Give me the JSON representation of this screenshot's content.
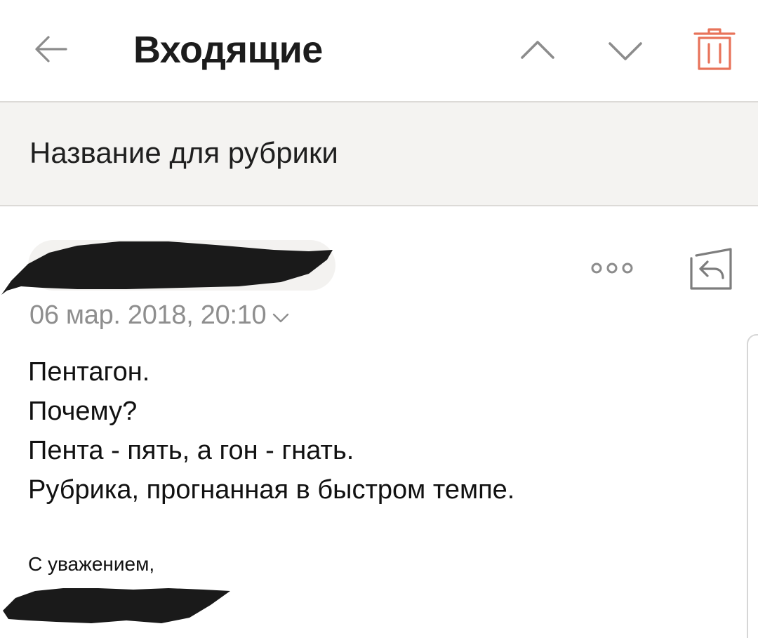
{
  "header": {
    "folder_title": "Входящие",
    "back_icon": "arrow-left-icon",
    "prev_icon": "chevron-up-icon",
    "next_icon": "chevron-down-icon",
    "delete_icon": "trash-icon"
  },
  "message": {
    "subject": "Название для рубрики",
    "sender_redacted": true,
    "date": "06 мар. 2018, 20:10",
    "date_toggle_icon": "chevron-down-icon",
    "more_icon": "more-dots-icon",
    "reply_icon": "reply-icon",
    "body_lines": [
      "Пентагон.",
      "Почему?",
      "Пента - пять, а гон - гнать.",
      "Рубрика, прогнанная в быстром темпе."
    ],
    "signature_greeting": "С уважением,",
    "signature_name_redacted": true
  },
  "colors": {
    "accent_delete": "#e8735a",
    "icon_gray": "#8c8c8c",
    "subject_band": "#f4f3f1",
    "date_text": "#8e8e8e",
    "redaction": "#1a1a1a"
  }
}
